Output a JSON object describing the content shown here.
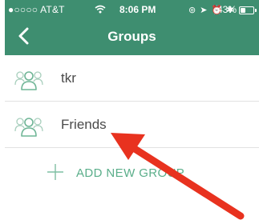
{
  "status_bar": {
    "carrier": "●○○○○ AT&T",
    "time": "8:06 PM",
    "battery_percent": "43%",
    "battery_level": 0.43,
    "icons": [
      "wifi-icon",
      "orientation-lock-icon",
      "location-icon",
      "alarm-icon",
      "bluetooth-icon",
      "battery-icon"
    ]
  },
  "nav": {
    "back_icon": "chevron-left-icon",
    "title": "Groups"
  },
  "groups": [
    {
      "name": "tkr",
      "icon": "group-people-icon"
    },
    {
      "name": "Friends",
      "icon": "group-people-icon"
    }
  ],
  "add_group": {
    "icon": "plus-icon",
    "label": "ADD NEW GROUP"
  },
  "annotation": {
    "type": "arrow",
    "color": "#e8321f",
    "points_to": "Friends"
  },
  "colors": {
    "header": "#3e8e70",
    "accent": "#5aae8a",
    "arrow": "#e8321f"
  }
}
